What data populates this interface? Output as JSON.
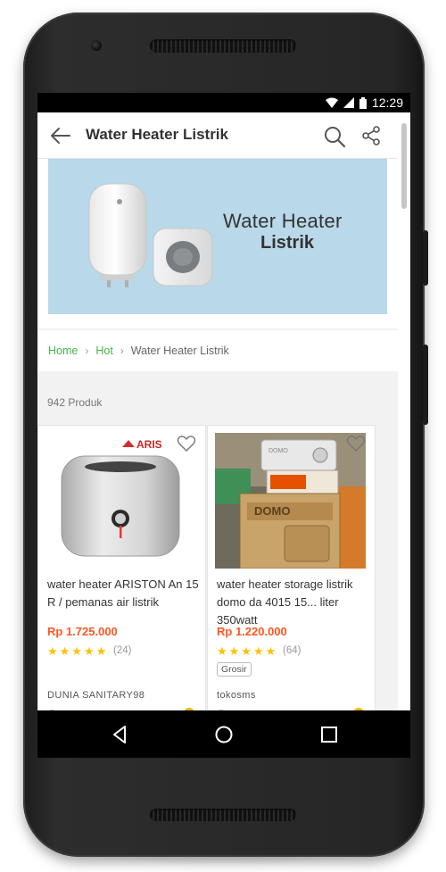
{
  "status_bar": {
    "time": "12:29"
  },
  "app_bar": {
    "title": "Water Heater Listrik",
    "back_icon": "arrow-left-icon",
    "search_icon": "search-icon",
    "share_icon": "share-icon"
  },
  "banner": {
    "line1": "Water Heater",
    "line2": "Listrik",
    "background": "#b9d8ea"
  },
  "breadcrumb": {
    "items": [
      "Home",
      "Hot"
    ],
    "current": "Water Heater Listrik"
  },
  "product_count": "942 Produk",
  "products": [
    {
      "title": "water heater ARISTON An 15 R / pemanas air listrik",
      "price": "Rp 1.725.000",
      "stars": "★★★★★",
      "rating": 5,
      "reviews": "(24)",
      "badge": "",
      "shop": "DUNIA SANITARY98",
      "brand_logo": "ARIS"
    },
    {
      "title": "water heater storage listrik domo da 4015 15... liter 350watt",
      "price": "Rp 1.220.000",
      "stars": "★★★★★",
      "rating": 5,
      "reviews": "(64)",
      "badge": "Grosir",
      "shop": "tokosms",
      "brand_logo": "DOMO"
    }
  ],
  "colors": {
    "accent_green": "#42b549",
    "price_orange": "#ff5722",
    "star_yellow": "#ffc107"
  },
  "nav": {
    "back": "nav-back-icon",
    "home": "nav-home-icon",
    "recents": "nav-recents-icon"
  }
}
